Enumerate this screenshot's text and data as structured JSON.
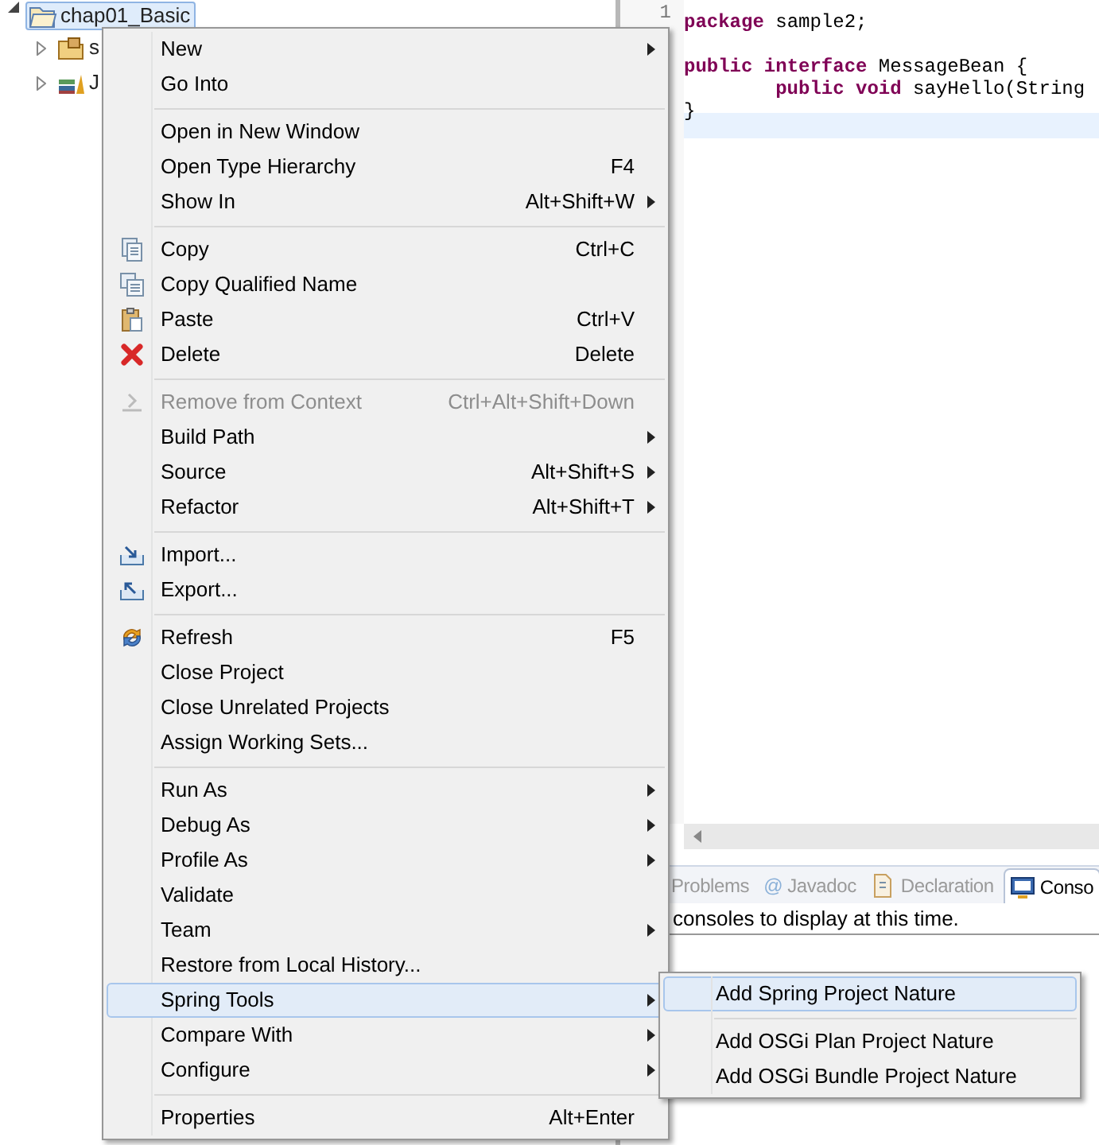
{
  "project_tree": [
    {
      "label": "chap01_Basic",
      "kind": "project",
      "selected": true,
      "expanded": true,
      "children": [
        {
          "label": "s",
          "kind": "package",
          "selected": false,
          "expanded": false
        },
        {
          "label": "J",
          "kind": "library",
          "selected": false,
          "expanded": false
        }
      ]
    }
  ],
  "editor": {
    "lines": [
      {
        "number": "1",
        "current": false,
        "tokens": [
          {
            "text": "package",
            "kind": "keyword"
          },
          {
            "text": " sample2;",
            "kind": "plain"
          }
        ]
      },
      {
        "current": false
      },
      {
        "current": false,
        "tokens": [
          {
            "text": "public",
            "kind": "keyword"
          },
          {
            "text": " interface",
            "kind": "keyword"
          },
          {
            "text": " MessageBean {",
            "kind": "plain"
          }
        ]
      },
      {
        "current": false,
        "tokens": [
          {
            "text": "        public",
            "kind": "keyword"
          },
          {
            "text": " void",
            "kind": "keyword"
          },
          {
            "text": " sayHello(String",
            "kind": "plain"
          }
        ]
      },
      {
        "current": false,
        "tokens": [
          {
            "text": "}",
            "kind": "plain"
          }
        ]
      },
      {
        "current": true
      }
    ]
  },
  "bottom_view": {
    "tabs": [
      {
        "label": "Problems",
        "kind": "problems",
        "selected": false
      },
      {
        "label": "Javadoc",
        "glyph": "@",
        "kind": "javadoc",
        "selected": false
      },
      {
        "label": "Declaration",
        "kind": "declaration",
        "selected": false
      },
      {
        "label": "Conso",
        "kind": "console",
        "selected": true
      }
    ],
    "message": "consoles to display at this time."
  },
  "context_menu": {
    "items": [
      {
        "kind": "item",
        "label": "New",
        "submenu": true,
        "disabled": false,
        "selected": false
      },
      {
        "kind": "item",
        "label": "Go Into",
        "submenu": false,
        "disabled": false,
        "selected": false
      },
      {
        "kind": "separator"
      },
      {
        "kind": "item",
        "label": "Open in New Window",
        "submenu": false,
        "disabled": false,
        "selected": false
      },
      {
        "kind": "item",
        "label": "Open Type Hierarchy",
        "shortcut": "F4",
        "submenu": false,
        "disabled": false,
        "selected": false
      },
      {
        "kind": "item",
        "label": "Show In",
        "shortcut": "Alt+Shift+W",
        "submenu": true,
        "disabled": false,
        "selected": false
      },
      {
        "kind": "separator"
      },
      {
        "label": "Copy",
        "shortcut": "Ctrl+C",
        "kind": "copy",
        "submenu": false,
        "disabled": false,
        "selected": false
      },
      {
        "label": "Copy Qualified Name",
        "kind": "copy-qualified",
        "submenu": false,
        "disabled": false,
        "selected": false
      },
      {
        "label": "Paste",
        "shortcut": "Ctrl+V",
        "kind": "paste",
        "submenu": false,
        "disabled": false,
        "selected": false
      },
      {
        "label": "Delete",
        "shortcut": "Delete",
        "kind": "delete",
        "submenu": false,
        "disabled": false,
        "selected": false
      },
      {
        "kind": "separator"
      },
      {
        "label": "Remove from Context",
        "shortcut": "Ctrl+Alt+Shift+Down",
        "kind": "remove",
        "submenu": false,
        "disabled": true,
        "selected": false
      },
      {
        "kind": "item",
        "label": "Build Path",
        "submenu": true,
        "disabled": false,
        "selected": false
      },
      {
        "kind": "item",
        "label": "Source",
        "shortcut": "Alt+Shift+S",
        "submenu": true,
        "disabled": false,
        "selected": false
      },
      {
        "kind": "item",
        "label": "Refactor",
        "shortcut": "Alt+Shift+T",
        "submenu": true,
        "disabled": false,
        "selected": false
      },
      {
        "kind": "separator"
      },
      {
        "label": "Import...",
        "kind": "import",
        "submenu": false,
        "disabled": false,
        "selected": false
      },
      {
        "label": "Export...",
        "kind": "export",
        "submenu": false,
        "disabled": false,
        "selected": false
      },
      {
        "kind": "separator"
      },
      {
        "label": "Refresh",
        "shortcut": "F5",
        "kind": "refresh",
        "submenu": false,
        "disabled": false,
        "selected": false
      },
      {
        "kind": "item",
        "label": "Close Project",
        "submenu": false,
        "disabled": false,
        "selected": false
      },
      {
        "kind": "item",
        "label": "Close Unrelated Projects",
        "submenu": false,
        "disabled": false,
        "selected": false
      },
      {
        "kind": "item",
        "label": "Assign Working Sets...",
        "submenu": false,
        "disabled": false,
        "selected": false
      },
      {
        "kind": "separator"
      },
      {
        "kind": "item",
        "label": "Run As",
        "submenu": true,
        "disabled": false,
        "selected": false
      },
      {
        "kind": "item",
        "label": "Debug As",
        "submenu": true,
        "disabled": false,
        "selected": false
      },
      {
        "kind": "item",
        "label": "Profile As",
        "submenu": true,
        "disabled": false,
        "selected": false
      },
      {
        "kind": "item",
        "label": "Validate",
        "submenu": false,
        "disabled": false,
        "selected": false
      },
      {
        "kind": "item",
        "label": "Team",
        "submenu": true,
        "disabled": false,
        "selected": false
      },
      {
        "kind": "item",
        "label": "Restore from Local History...",
        "submenu": false,
        "disabled": false,
        "selected": false
      },
      {
        "kind": "item",
        "label": "Spring Tools",
        "submenu": true,
        "disabled": false,
        "selected": true
      },
      {
        "kind": "item",
        "label": "Compare With",
        "submenu": true,
        "disabled": false,
        "selected": false
      },
      {
        "kind": "item",
        "label": "Configure",
        "submenu": true,
        "disabled": false,
        "selected": false
      },
      {
        "kind": "separator"
      },
      {
        "kind": "item",
        "label": "Properties",
        "shortcut": "Alt+Enter",
        "submenu": false,
        "disabled": false,
        "selected": false
      }
    ]
  },
  "submenu": {
    "items": [
      {
        "kind": "item",
        "label": "Add Spring Project Nature",
        "selected": true
      },
      {
        "kind": "separator"
      },
      {
        "kind": "item",
        "label": "Add OSGi Plan Project Nature",
        "selected": false
      },
      {
        "kind": "item",
        "label": "Add OSGi Bundle Project Nature",
        "selected": false
      }
    ]
  }
}
